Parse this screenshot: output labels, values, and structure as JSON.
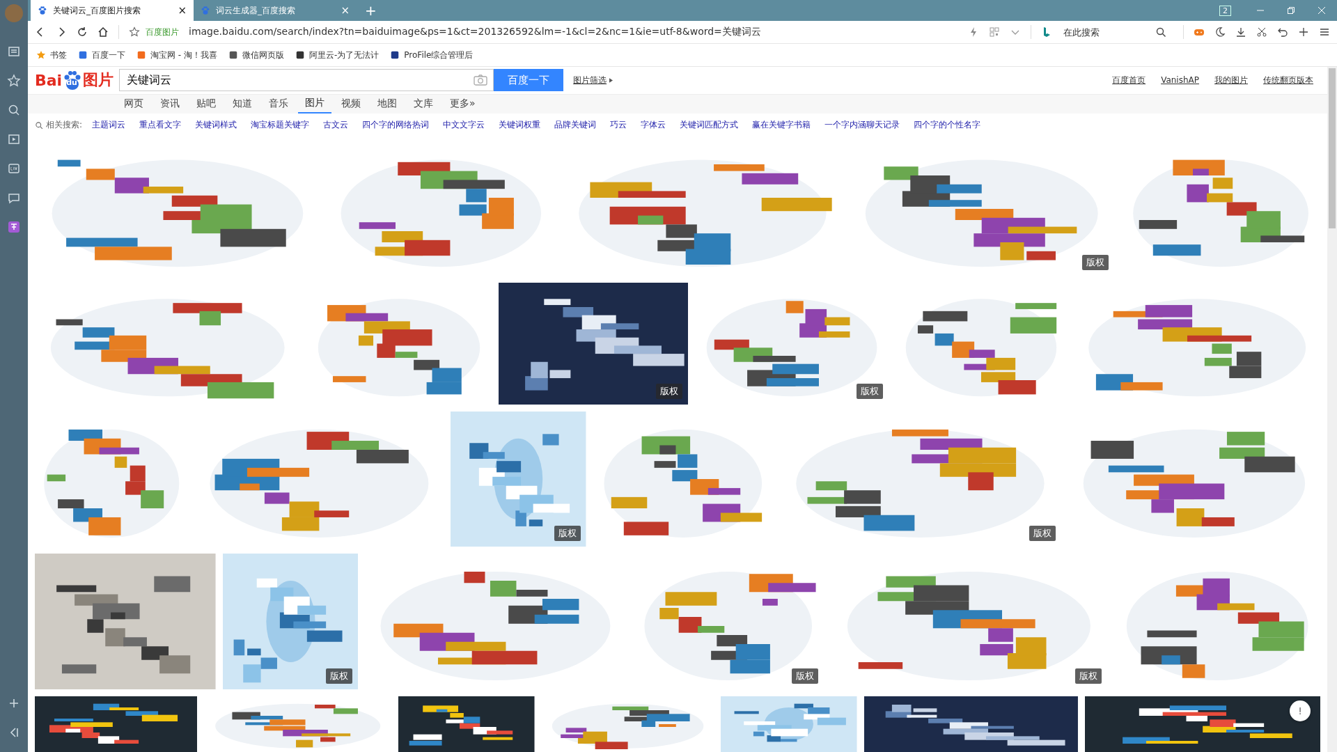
{
  "browser": {
    "tabs": [
      {
        "title": "关键词云_百度图片搜索",
        "selected": true,
        "close": "×"
      },
      {
        "title": "词云生成器_百度搜索",
        "selected": false,
        "close": "×"
      }
    ],
    "new_tab": "+",
    "tab_count": "2",
    "site_label": "百度图片",
    "url": "image.baidu.com/search/index?tn=baiduimage&ps=1&ct=201326592&lm=-1&cl=2&nc=1&ie=utf-8&word=关键词云",
    "search_placeholder": "在此搜索",
    "bookmarks": [
      "书签",
      "百度一下",
      "淘宝网 - 淘！我喜",
      "微信网页版",
      "阿里云-为了无法计",
      "ProFile综合管理后"
    ]
  },
  "page": {
    "logo": {
      "left": "Bai",
      "mark": "du",
      "right": "图片"
    },
    "search": {
      "value": "关键词云",
      "button": "百度一下",
      "filter": "图片筛选"
    },
    "top_links": [
      "百度首页",
      "VanishAP",
      "我的图片",
      "传统翻页版本"
    ],
    "nav": [
      {
        "label": "网页",
        "selected": false
      },
      {
        "label": "资讯",
        "selected": false
      },
      {
        "label": "贴吧",
        "selected": false
      },
      {
        "label": "知道",
        "selected": false
      },
      {
        "label": "音乐",
        "selected": false
      },
      {
        "label": "图片",
        "selected": true
      },
      {
        "label": "视频",
        "selected": false
      },
      {
        "label": "地图",
        "selected": false
      },
      {
        "label": "文库",
        "selected": false
      },
      {
        "label": "更多»",
        "selected": false
      }
    ],
    "related_label": "相关搜索:",
    "related": [
      "主题词云",
      "重点看文字",
      "关键词样式",
      "淘宝标题关键字",
      "古文云",
      "四个字的网络热词",
      "中文文字云",
      "关键词权重",
      "品牌关键词",
      "巧云",
      "字体云",
      "关键词匹配方式",
      "赢在关键字书籍",
      "一个字内涵聊天记录",
      "四个字的个性名字"
    ],
    "image_rows": [
      [
        {
          "kind": "picture"
        },
        {
          "kind": "picture"
        },
        {
          "kind": "picture"
        },
        {
          "kind": "picture",
          "badge": "版权"
        },
        {
          "kind": "picture"
        }
      ],
      [
        {
          "kind": "picture"
        },
        {
          "kind": "picture"
        },
        {
          "kind": "picture",
          "badge": "版权"
        },
        {
          "kind": "picture",
          "badge": "版权"
        },
        {
          "kind": "picture"
        },
        {
          "kind": "picture"
        }
      ],
      [
        {
          "kind": "picture"
        },
        {
          "kind": "picture"
        },
        {
          "kind": "picture",
          "badge": "版权"
        },
        {
          "kind": "picture"
        },
        {
          "kind": "picture",
          "badge": "版权"
        },
        {
          "kind": "picture"
        }
      ],
      [
        {
          "kind": "picture"
        },
        {
          "kind": "picture",
          "badge": "版权"
        },
        {
          "kind": "picture"
        },
        {
          "kind": "picture",
          "badge": "版权"
        },
        {
          "kind": "picture",
          "badge": "版权"
        },
        {
          "kind": "picture"
        }
      ],
      [
        {
          "kind": "picture"
        },
        {
          "kind": "picture"
        },
        {
          "kind": "picture"
        },
        {
          "kind": "picture"
        },
        {
          "kind": "picture"
        },
        {
          "kind": "picture"
        },
        {
          "kind": "picture"
        }
      ]
    ],
    "feedback": "!"
  }
}
